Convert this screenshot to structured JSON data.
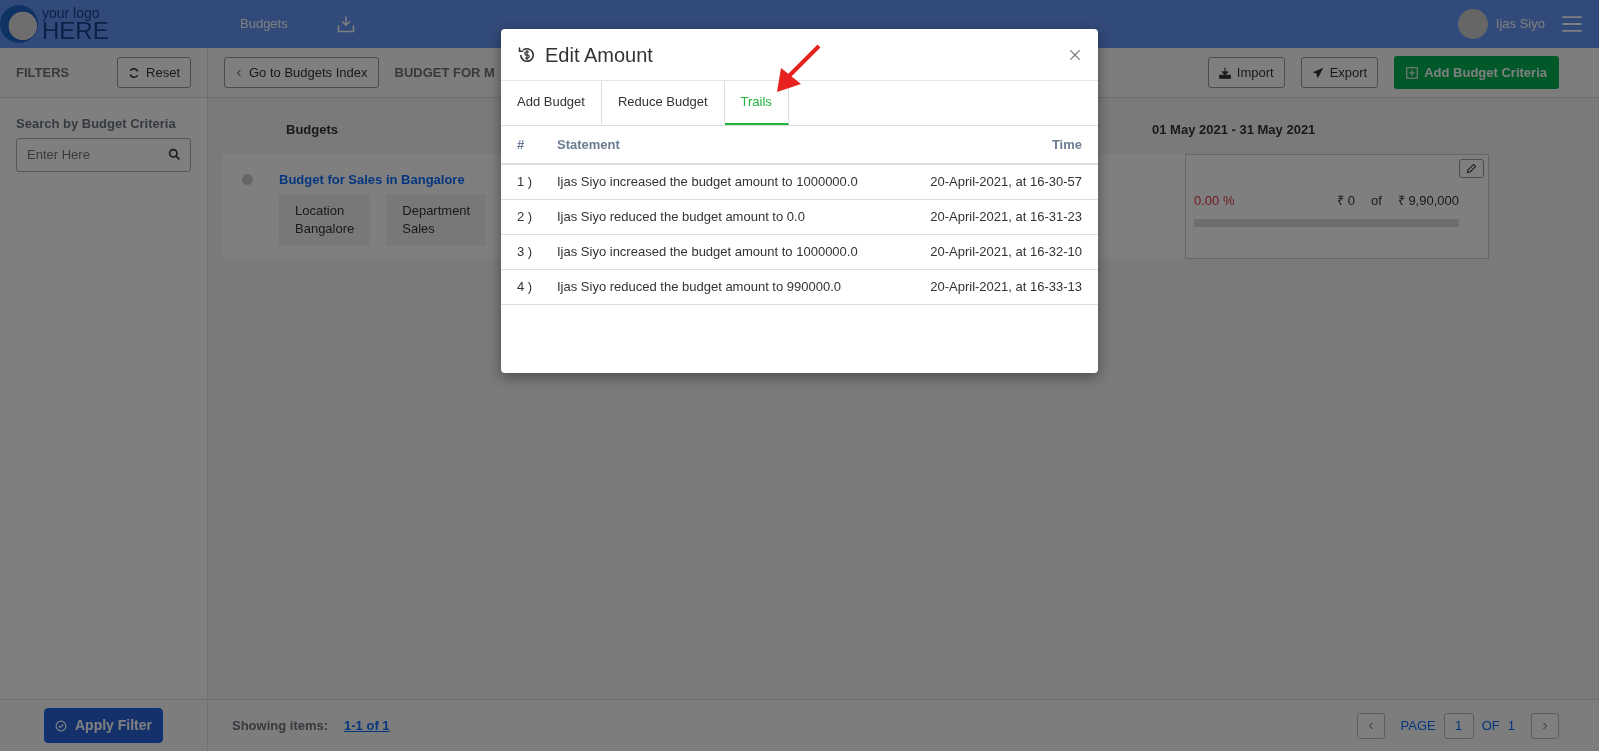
{
  "header": {
    "logo": {
      "line1": "your logo",
      "line2": "HERE"
    },
    "nav": [
      {
        "label": "Budgets"
      }
    ],
    "user_name": "Ijas Siyo"
  },
  "toolbar": {
    "filters_title": "FILTERS",
    "reset": "Reset",
    "back": "Go to Budgets Index",
    "page_title": "BUDGET FOR M",
    "import": "Import",
    "export": "Export",
    "add": "Add Budget Criteria"
  },
  "sidebar": {
    "search_label": "Search by Budget Criteria",
    "search": {
      "placeholder": "Enter Here"
    },
    "apply": "Apply Filter"
  },
  "table": {
    "columns": [
      "Budgets",
      "01 May 2021 - 31 May 2021"
    ],
    "rows": [
      {
        "title": "Budget for Sales in Bangalore",
        "tags": [
          {
            "label": "Location",
            "value": "Bangalore"
          },
          {
            "label": "Department",
            "value": "Sales"
          }
        ],
        "percent": "0.00 %",
        "spent": "₹ 0",
        "of": "of",
        "total": "₹ 9,90,000",
        "level": 0
      }
    ]
  },
  "footer": {
    "showing_label": "Showing items:",
    "range": "1-1 of 1",
    "page_label": "PAGE",
    "page": "1",
    "of_label": "OF",
    "page_count": "1"
  },
  "modal": {
    "title": "Edit Amount",
    "tabs": [
      {
        "label": "Add Budget",
        "selected": false
      },
      {
        "label": "Reduce Budget",
        "selected": false
      },
      {
        "label": "Trails",
        "selected": true
      }
    ],
    "columns": [
      "#",
      "Statement",
      "Time"
    ],
    "rows": [
      {
        "number": "1 )",
        "statement": "Ijas Siyo increased the budget amount to 1000000.0",
        "time": "20-April-2021, at 16-30-57"
      },
      {
        "number": "2 )",
        "statement": "Ijas Siyo reduced the budget amount to 0.0",
        "time": "20-April-2021, at 16-31-23"
      },
      {
        "number": "3 )",
        "statement": "Ijas Siyo increased the budget amount to 1000000.0",
        "time": "20-April-2021, at 16-32-10"
      },
      {
        "number": "4 )",
        "statement": "Ijas Siyo reduced the budget amount to 990000.0",
        "time": "20-April-2021, at 16-33-13"
      }
    ]
  }
}
